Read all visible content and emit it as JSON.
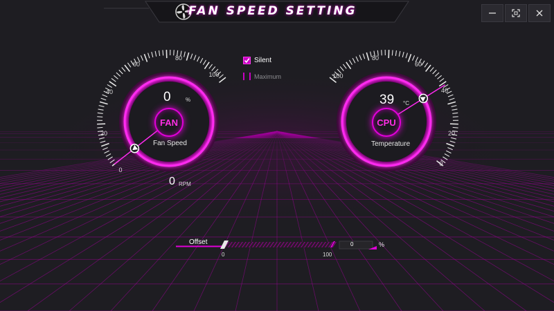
{
  "window": {
    "title": "FAN SPEED SETTING",
    "accent": "#e000d8",
    "background": "#1e1d22",
    "controls": {
      "minimize_icon": "minimize-icon",
      "maximize_icon": "restore-icon",
      "close_icon": "close-icon"
    }
  },
  "fan_gauge": {
    "speed_value": "0",
    "speed_unit": "%",
    "center_label": "FAN",
    "caption": "Fan Speed",
    "rpm_value": "0",
    "rpm_unit": "RPM",
    "scale": [
      "0",
      "20",
      "40",
      "60",
      "80",
      "100"
    ],
    "needle_percent": 0
  },
  "cpu_gauge": {
    "temp_value": "39",
    "temp_unit": "°C",
    "center_label": "CPU",
    "caption": "Temperature",
    "scale": [
      "100",
      "80",
      "60",
      "40",
      "20",
      "0"
    ],
    "needle_percent": 39
  },
  "modes": {
    "silent": {
      "label": "Silent",
      "checked": true
    },
    "maximum": {
      "label": "Maximum",
      "checked": false
    }
  },
  "offset": {
    "label": "Offset",
    "min_label": "0",
    "max_label": "100",
    "value": "0",
    "unit": "%"
  }
}
